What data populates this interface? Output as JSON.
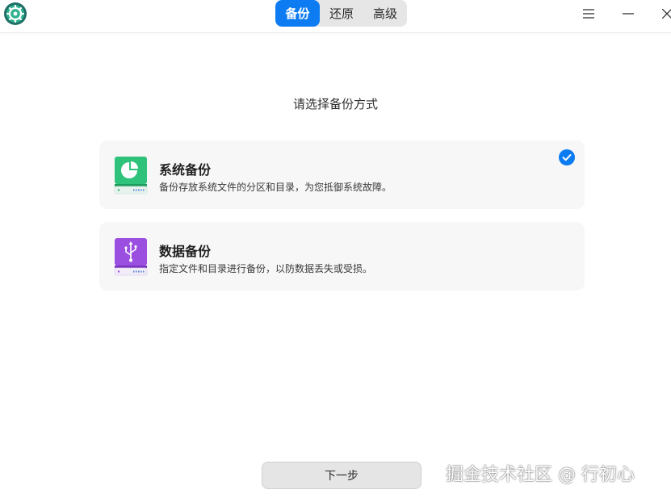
{
  "titlebar": {
    "tabs": [
      {
        "label": "备份",
        "active": true
      },
      {
        "label": "还原",
        "active": false
      },
      {
        "label": "高级",
        "active": false
      }
    ],
    "icons": {
      "app": "backup-restore-app-icon",
      "menu": "menu-icon",
      "minimize": "minimize-icon",
      "close": "close-icon"
    }
  },
  "main": {
    "heading": "请选择备份方式",
    "options": [
      {
        "title": "系统备份",
        "description": "备份存放系统文件的分区和目录，为您抵御系统故障。",
        "icon": "system-backup-disk-icon",
        "selected": true
      },
      {
        "title": "数据备份",
        "description": "指定文件和目录进行备份，以防数据丢失或受损。",
        "icon": "data-backup-usb-disk-icon",
        "selected": false
      }
    ],
    "next_label": "下一步"
  },
  "watermark": "掘金技术社区 @ 行初心",
  "colors": {
    "accent": "#0d7cf2",
    "system_icon": "#2fc27a",
    "data_icon": "#9b4fe0",
    "card_bg": "#f7f7f7"
  }
}
